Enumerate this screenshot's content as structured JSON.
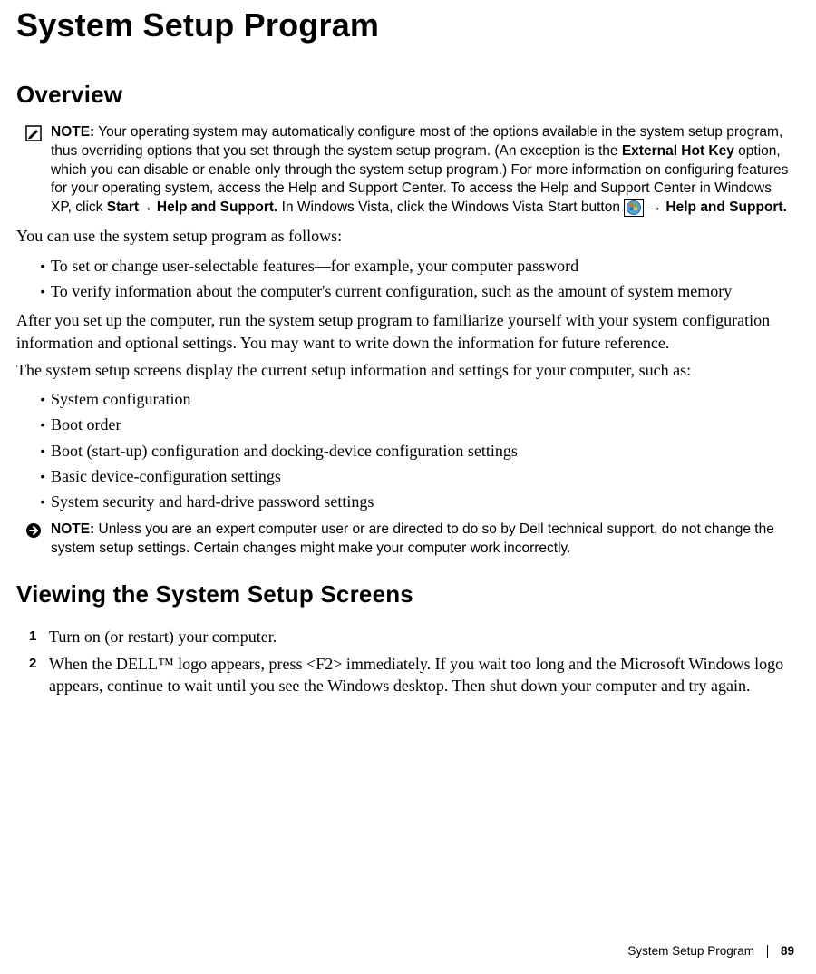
{
  "page": {
    "title": "System Setup Program",
    "section_overview": "Overview",
    "section_viewing": "Viewing the System Setup Screens",
    "footer_label": "System Setup Program",
    "page_number": "89"
  },
  "note1": {
    "lead": "NOTE:",
    "seg1": " Your operating system may automatically configure most of the options available in the system setup program, thus overriding options that you set through the system setup program. (An exception is the ",
    "bold1": "External Hot Key",
    "seg2": " option, which you can disable or enable only through the system setup program.) For more information on configuring features for your operating system, access the Help and Support Center. To access the Help and Support Center in Windows XP, click ",
    "bold2": "Start",
    "arrow1": "→ ",
    "bold3": "Help and Support.",
    "seg3": " In Windows Vista, click the Windows Vista Start button ",
    "arrow2": " → ",
    "bold4": "Help and Support."
  },
  "body": {
    "p1": "You can use the system setup program as follows:",
    "bullets1": [
      "To set or change user-selectable features—for example, your computer password",
      "To verify information about the computer's current configuration, such as the amount of system memory"
    ],
    "p2": "After you set up the computer, run the system setup program to familiarize yourself with your system configuration information and optional settings. You may want to write down the information for future reference.",
    "p3": "The system setup screens display the current setup information and settings for your computer, such as:",
    "bullets2": [
      "System configuration",
      "Boot order",
      "Boot (start-up) configuration and docking-device configuration settings",
      "Basic device-configuration settings",
      "System security and hard-drive password settings"
    ]
  },
  "note2": {
    "lead": "NOTE:",
    "text": " Unless you are an expert computer user or are directed to do so by Dell technical support, do not change the system setup settings. Certain changes might make your computer work incorrectly."
  },
  "steps": [
    "Turn on (or restart) your computer.",
    "When the DELL™ logo appears, press <F2> immediately. If you wait too long and the Microsoft Windows logo appears, continue to wait until you see the Windows desktop. Then shut down your computer and try again."
  ]
}
